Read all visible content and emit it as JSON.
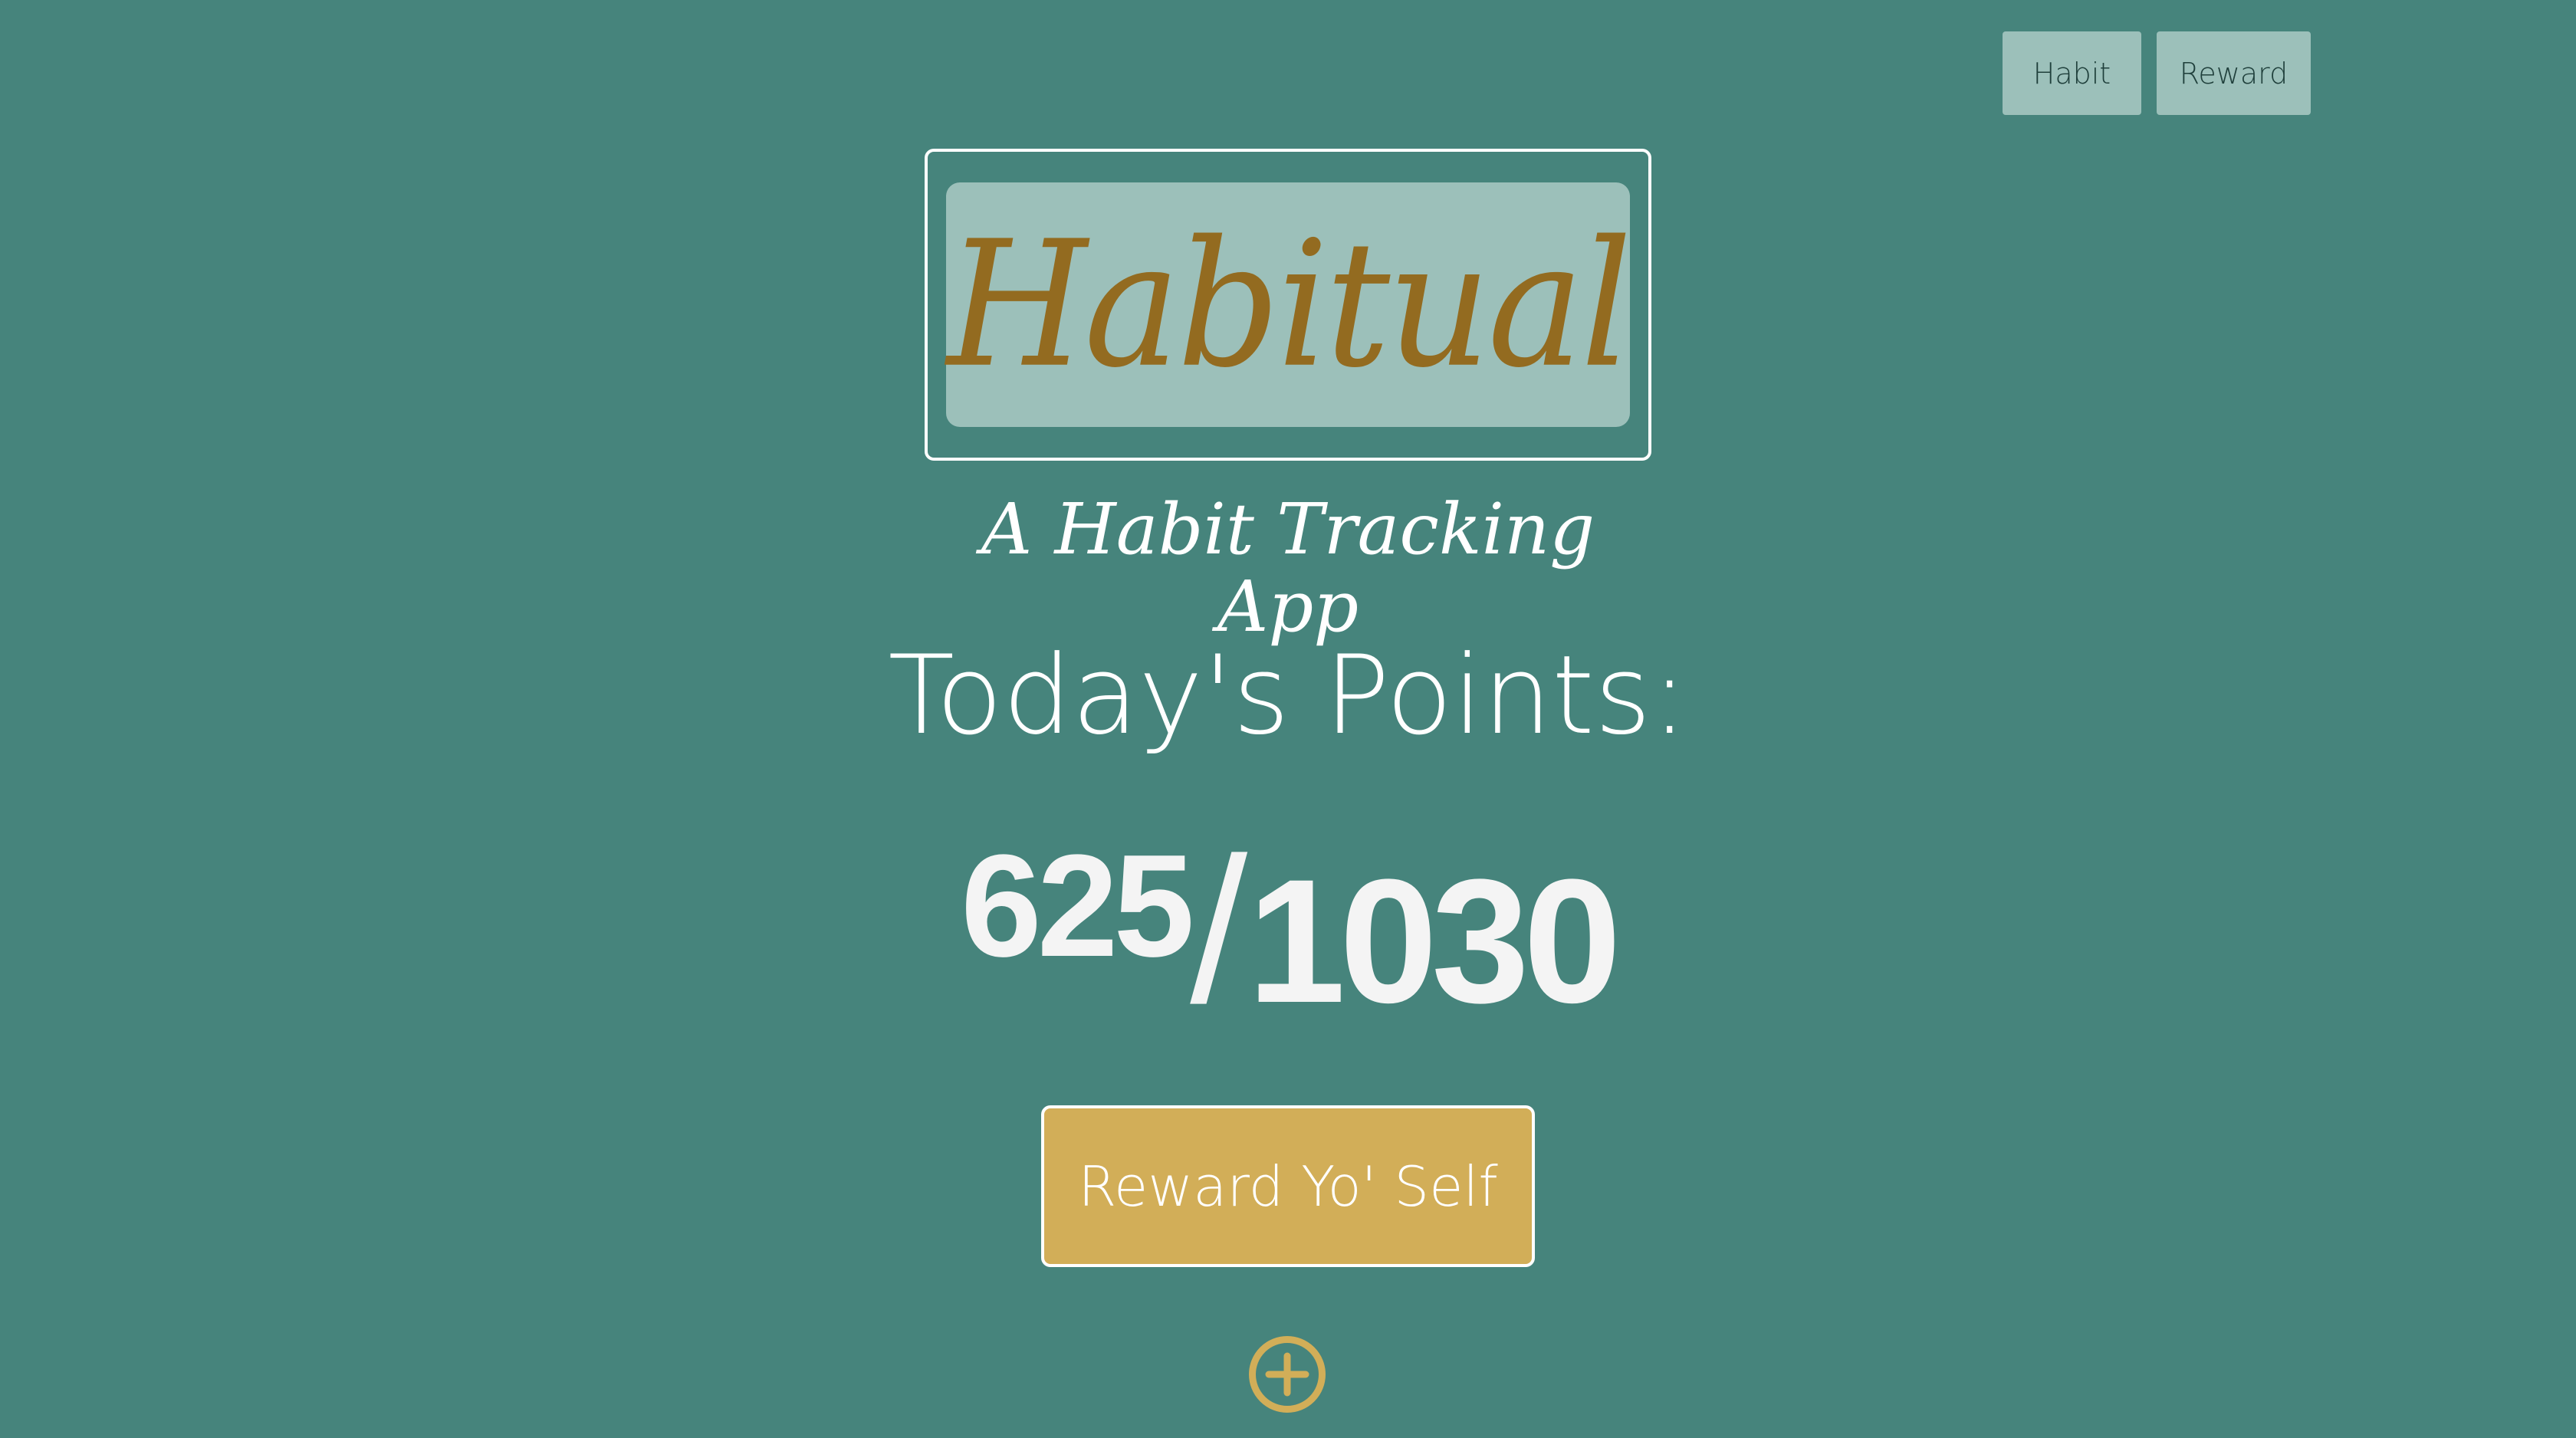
{
  "nav": {
    "habit_label": "Habit",
    "reward_label": "Reward"
  },
  "logo": {
    "text": "Habitual"
  },
  "tagline": "A Habit Tracking App",
  "points": {
    "title": "Today's Points:",
    "current": "625",
    "separator": "/",
    "total": "1030"
  },
  "actions": {
    "reward_label": "Reward Yo' Self",
    "add_icon": "plus-circle-icon"
  },
  "colors": {
    "background": "#46847c",
    "panel": "#9cc0ba",
    "accent_gold": "#d2ae58",
    "logo_text": "#936b20",
    "text": "#ffffff"
  }
}
